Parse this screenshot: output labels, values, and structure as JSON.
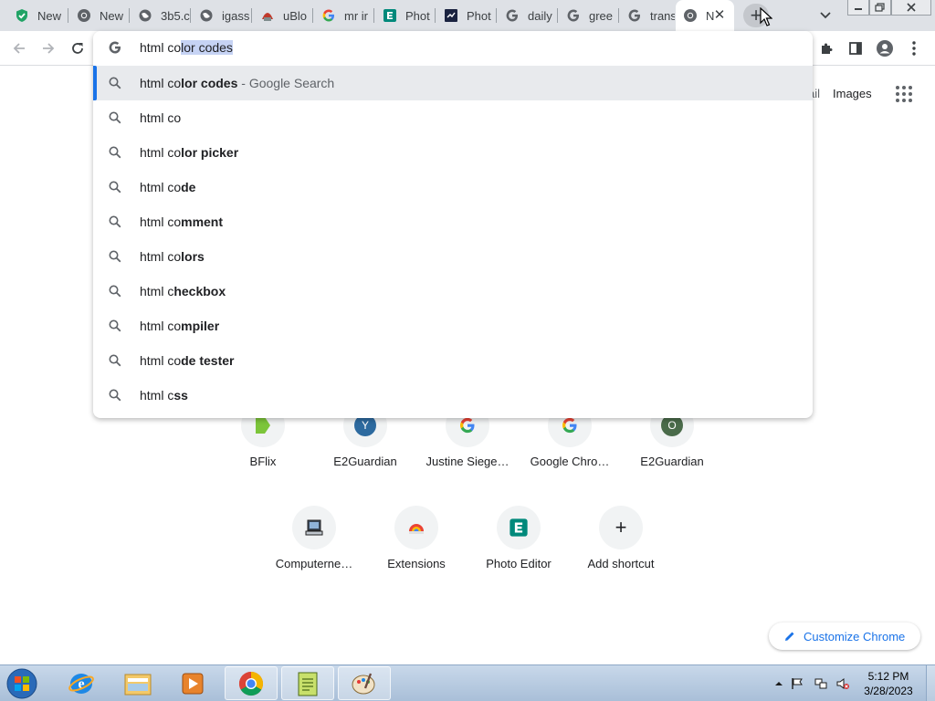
{
  "browser": {
    "tabs": [
      {
        "title": "New",
        "icon": "shield-check-icon"
      },
      {
        "title": "New",
        "icon": "chrome-icon"
      },
      {
        "title": "3b5.c",
        "icon": "globe-icon"
      },
      {
        "title": "igass",
        "icon": "globe-icon"
      },
      {
        "title": "uBlo",
        "icon": "ublock-icon"
      },
      {
        "title": "mr ir",
        "icon": "google-icon"
      },
      {
        "title": "Phot",
        "icon": "photo-editor-icon"
      },
      {
        "title": "Phot",
        "icon": "photo-editor-dark-icon"
      },
      {
        "title": "daily",
        "icon": "google-icon"
      },
      {
        "title": "gree",
        "icon": "google-icon"
      },
      {
        "title": "trans",
        "icon": "google-icon"
      },
      {
        "title": "N",
        "icon": "chrome-icon",
        "active": true
      }
    ],
    "new_tab_symbol": "+",
    "close_symbol": "✕"
  },
  "omnibox": {
    "typed_text": "html co",
    "autocomplete_text": "lor codes",
    "suggestions": [
      {
        "prefix": "html co",
        "bold": "lor codes",
        "suffix": " - Google Search",
        "selected": true
      },
      {
        "prefix": "html co",
        "bold": "",
        "suffix": ""
      },
      {
        "prefix": "html co",
        "bold": "lor picker",
        "suffix": ""
      },
      {
        "prefix": "html co",
        "bold": "de",
        "suffix": ""
      },
      {
        "prefix": "html co",
        "bold": "mment",
        "suffix": ""
      },
      {
        "prefix": "html co",
        "bold": "lors",
        "suffix": ""
      },
      {
        "prefix": "html c",
        "bold": "heckbox",
        "suffix": ""
      },
      {
        "prefix": "html co",
        "bold": "mpiler",
        "suffix": ""
      },
      {
        "prefix": "html co",
        "bold": "de tester",
        "suffix": ""
      },
      {
        "prefix": "html c",
        "bold": "ss",
        "suffix": ""
      }
    ]
  },
  "ntp": {
    "gmail_partial": "ail",
    "images_link": "Images",
    "shortcuts_row1": [
      {
        "label": "BFlix",
        "icon": "bflix-icon"
      },
      {
        "label": "E2Guardian",
        "icon": "letter-y-icon",
        "letter": "Y"
      },
      {
        "label": "Justine Siege…",
        "icon": "google-icon"
      },
      {
        "label": "Google Chro…",
        "icon": "google-icon"
      },
      {
        "label": "E2Guardian",
        "icon": "letter-o-icon",
        "letter": "O"
      }
    ],
    "shortcuts_row2": [
      {
        "label": "Computerne…",
        "icon": "computer-icon"
      },
      {
        "label": "Extensions",
        "icon": "chrome-webstore-icon"
      },
      {
        "label": "Photo Editor",
        "icon": "photo-editor-icon"
      },
      {
        "label": "Add shortcut",
        "icon": "plus-icon",
        "symbol": "+"
      }
    ],
    "customize_label": "Customize Chrome"
  },
  "taskbar": {
    "apps": [
      "internet-explorer-icon",
      "windows-explorer-icon",
      "media-player-icon",
      "chrome-icon",
      "notepad-icon",
      "paint-icon"
    ],
    "time": "5:12 PM",
    "date": "3/28/2023"
  },
  "colors": {
    "accent": "#1a73e8",
    "tabstrip": "#dee1e6",
    "selection": "#c6d3f4"
  }
}
